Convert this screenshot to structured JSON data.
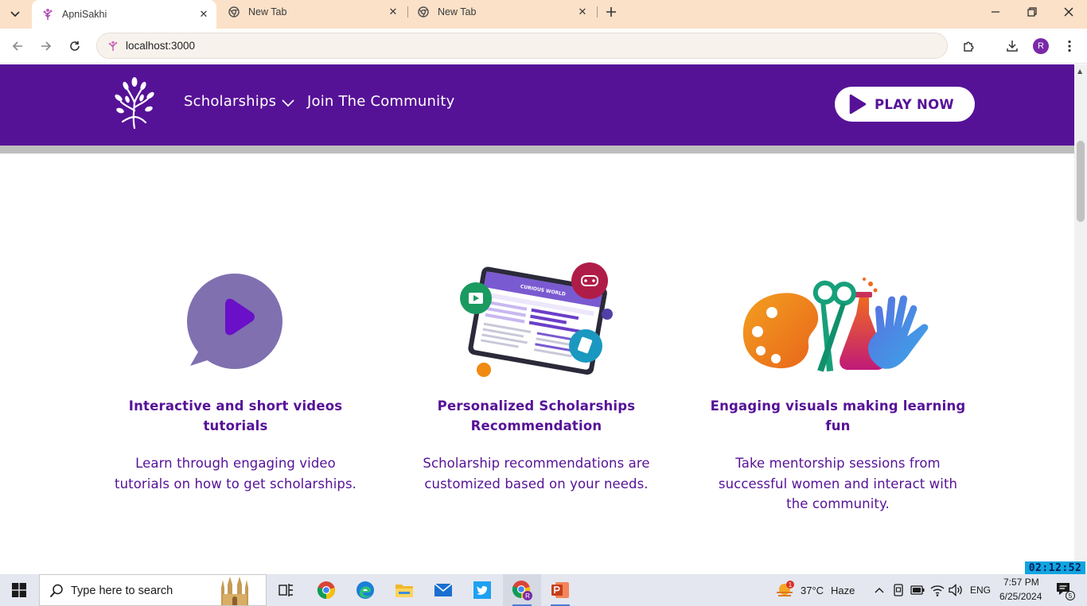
{
  "browser": {
    "tabs": [
      {
        "title": "ApniSakhi",
        "active": true
      },
      {
        "title": "New Tab",
        "active": false
      },
      {
        "title": "New Tab",
        "active": false
      }
    ],
    "address": "localhost:3000",
    "profile_initial": "R"
  },
  "site": {
    "nav": {
      "links": [
        "Scholarships",
        "Join The Community"
      ],
      "cta": "PLAY NOW"
    },
    "features": [
      {
        "title_lines": [
          "Interactive and short videos tutorials"
        ],
        "desc_lines": [
          "Learn through engaging video",
          "tutorials on how to get scholarships."
        ]
      },
      {
        "title_lines": [
          "Personalized Scholarships",
          "Recommendation"
        ],
        "desc_lines": [
          "Scholarship recommendations are",
          "customized based on your needs."
        ],
        "image_text": "CURIOUS WORLD"
      },
      {
        "title_lines": [
          "Engaging visuals making learning",
          "fun"
        ],
        "desc_lines": [
          "Take mentorship sessions from",
          "successful women and interact with",
          "the community."
        ]
      }
    ]
  },
  "taskbar": {
    "search_placeholder": "Type here to search",
    "weather": {
      "temp": "37°C",
      "condition": "Haze",
      "badge": "1"
    },
    "language": "ENG",
    "time": "7:57 PM",
    "date": "6/25/2024",
    "notification_count": "5",
    "overlay_timer": "02:12:52"
  },
  "colors": {
    "brand_purple": "#561297",
    "tab_strip": "#fbe1c8",
    "play_icon_bubble": "#8070b0"
  }
}
